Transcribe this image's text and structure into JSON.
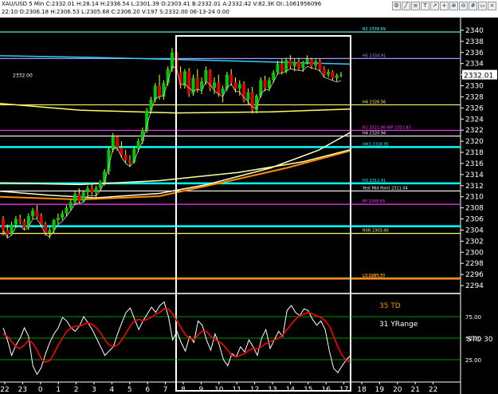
{
  "header": {
    "line1": "XAU/USD 5 Min  C:2332.01  H:28.14  H:2336.54  L:2301.39  O:2303.41  B:2332.01  A:2332.42  V:82.3K  OI:.1061956096",
    "line2": "22:10  O:2306.18  H:2306.53  L:2305.68  C:2306.20  V:197  S:2332.00  06-13-24  0:00"
  },
  "tools": [
    "gear-icon",
    "line-icon",
    "fib-icon",
    "text-icon",
    "arrow-icon",
    "cross-icon",
    "zoom-in-icon",
    "zoom-out-icon",
    "grid-icon",
    "window-icon",
    "close-icon"
  ],
  "price_label_left": "2332.00",
  "last_price": "2332.01",
  "colors": {
    "background": "#000000",
    "candle": "#00cc00",
    "cyan": "#00ffff",
    "yellow": "#ffff66",
    "orange": "#ff8c00",
    "magenta": "#ff00ff",
    "white": "#ffffff",
    "red": "#ff0000",
    "wick": "#ffff00"
  },
  "chart_data": [
    {
      "type": "candlestick",
      "ylim": [
        2293,
        2342
      ],
      "y_ticks": [
        "2340.00",
        "2338.00",
        "2336.00",
        "2334.00",
        "2332.00",
        "2330.00",
        "2328.00",
        "2326.00",
        "2324.00",
        "2322.00",
        "2320.00",
        "2318.00",
        "2316.00",
        "2314.00",
        "2312.00",
        "2310.00",
        "2308.00",
        "2306.00",
        "2304.00",
        "2302.00",
        "2300.00",
        "2298.00",
        "2296.00",
        "2294.00"
      ],
      "x_ticks": [
        "22",
        "23",
        "0",
        "1",
        "2",
        "3",
        "4",
        "5",
        "6",
        "7",
        "8",
        "9",
        "10",
        "11",
        "12",
        "13",
        "14",
        "15",
        "16",
        "17",
        "18",
        "19",
        "20",
        "21",
        "22"
      ],
      "candles": [
        [
          2306,
          2306.5,
          2303,
          2304
        ],
        [
          2304,
          2305,
          2302.5,
          2303.2
        ],
        [
          2303.2,
          2305.5,
          2303,
          2305
        ],
        [
          2305,
          2306.5,
          2304.5,
          2306
        ],
        [
          2306,
          2306.8,
          2305,
          2305.5
        ],
        [
          2305.5,
          2306,
          2304,
          2304.5
        ],
        [
          2304.5,
          2307,
          2304,
          2306.5
        ],
        [
          2306.5,
          2308,
          2306,
          2307.5
        ],
        [
          2307.5,
          2308.5,
          2306,
          2306.5
        ],
        [
          2306.5,
          2307,
          2304.5,
          2305
        ],
        [
          2305,
          2305.5,
          2303,
          2303.5
        ],
        [
          2303.5,
          2304.5,
          2302.5,
          2304
        ],
        [
          2304,
          2306,
          2303.5,
          2305.8
        ],
        [
          2305.8,
          2307,
          2305,
          2306.2
        ],
        [
          2306.2,
          2307.5,
          2305.8,
          2307
        ],
        [
          2307,
          2308.5,
          2306.5,
          2308
        ],
        [
          2308,
          2309.5,
          2307.5,
          2309
        ],
        [
          2309,
          2311,
          2308.5,
          2310.5
        ],
        [
          2310.5,
          2311.5,
          2308.8,
          2309.2
        ],
        [
          2309.2,
          2311,
          2309,
          2310.8
        ],
        [
          2310.8,
          2312,
          2310,
          2311.5
        ],
        [
          2311.5,
          2312.2,
          2310.3,
          2310.8
        ],
        [
          2310.8,
          2312,
          2309.5,
          2311.6
        ],
        [
          2311.6,
          2313,
          2311,
          2312.6
        ],
        [
          2312.6,
          2315,
          2312,
          2314.6
        ],
        [
          2314.6,
          2319,
          2314,
          2318.5
        ],
        [
          2318.5,
          2321.5,
          2318,
          2320.8
        ],
        [
          2320.8,
          2321,
          2318.3,
          2318.8
        ],
        [
          2318.8,
          2320,
          2317,
          2317.5
        ],
        [
          2317.5,
          2318.5,
          2316,
          2316.6
        ],
        [
          2316.6,
          2317.5,
          2315.5,
          2316.2
        ],
        [
          2316.2,
          2319,
          2316,
          2318.6
        ],
        [
          2318.6,
          2320.5,
          2318,
          2320
        ],
        [
          2320,
          2322.5,
          2319.5,
          2322
        ],
        [
          2322,
          2326,
          2321.5,
          2325.5
        ],
        [
          2325.5,
          2328,
          2325,
          2327.5
        ],
        [
          2327.5,
          2330.5,
          2327,
          2330
        ],
        [
          2330,
          2332,
          2327.5,
          2328
        ],
        [
          2328,
          2331,
          2327.5,
          2330.5
        ],
        [
          2330.5,
          2333.5,
          2330,
          2333
        ],
        [
          2333,
          2336.8,
          2332.5,
          2336
        ],
        [
          2336,
          2336.5,
          2331.5,
          2332.4
        ],
        [
          2332.4,
          2333.5,
          2329.5,
          2330
        ],
        [
          2330,
          2333,
          2329.5,
          2332.6
        ],
        [
          2332.6,
          2333.2,
          2328,
          2328.6
        ],
        [
          2328.6,
          2332,
          2328.2,
          2331.4
        ],
        [
          2331.4,
          2333,
          2328.8,
          2329.4
        ],
        [
          2329.4,
          2331.5,
          2328.5,
          2330.8
        ],
        [
          2330.8,
          2333.5,
          2330.2,
          2332.8
        ],
        [
          2332.8,
          2333,
          2329,
          2329.6
        ],
        [
          2329.6,
          2331.5,
          2328.5,
          2330.6
        ],
        [
          2330.6,
          2332,
          2328,
          2328.5
        ],
        [
          2328.5,
          2330,
          2327,
          2329.5
        ],
        [
          2329.5,
          2332.5,
          2329,
          2332
        ],
        [
          2332,
          2333,
          2330,
          2330.6
        ],
        [
          2330.6,
          2331.5,
          2328.8,
          2329.5
        ],
        [
          2329.5,
          2331,
          2328.2,
          2330.3
        ],
        [
          2330.3,
          2330.8,
          2327,
          2327.5
        ],
        [
          2327.5,
          2329.5,
          2326.5,
          2328.8
        ],
        [
          2328.8,
          2329.8,
          2325,
          2325.6
        ],
        [
          2325.6,
          2328.5,
          2325,
          2328.2
        ],
        [
          2328.2,
          2331.5,
          2327.8,
          2331
        ],
        [
          2331,
          2331.8,
          2329,
          2329.6
        ],
        [
          2329.6,
          2331.5,
          2329,
          2331
        ],
        [
          2331,
          2332.8,
          2330.5,
          2332.4
        ],
        [
          2332.4,
          2334.5,
          2332,
          2334
        ],
        [
          2334,
          2334.8,
          2332,
          2332.6
        ],
        [
          2332.6,
          2335,
          2332.2,
          2334.6
        ],
        [
          2334.6,
          2335.5,
          2333,
          2333.5
        ],
        [
          2333.5,
          2334.8,
          2332.6,
          2334.3
        ],
        [
          2334.3,
          2335,
          2332.8,
          2333.2
        ],
        [
          2333.2,
          2334.5,
          2332.5,
          2334.2
        ],
        [
          2334.2,
          2335.5,
          2333.8,
          2334.8
        ],
        [
          2334.8,
          2335,
          2333,
          2333.6
        ],
        [
          2333.6,
          2334.8,
          2333,
          2334.4
        ],
        [
          2334.4,
          2334.8,
          2332.5,
          2333
        ],
        [
          2333,
          2333.5,
          2331.5,
          2332
        ],
        [
          2332,
          2333,
          2331.5,
          2332.5
        ],
        [
          2332.5,
          2332.8,
          2331,
          2331.4
        ],
        [
          2331.4,
          2332.2,
          2330.8,
          2331.9
        ],
        [
          2331.9,
          2332.5,
          2331.5,
          2332.01
        ]
      ],
      "levels": [
        {
          "price": 2339.69,
          "label": "R2  2339.69",
          "color": "#66ffff"
        },
        {
          "price": 2334.91,
          "label": "H5  2334.91",
          "color": "#9999ff"
        },
        {
          "price": 2326.56,
          "label": "H4  2326.56",
          "color": "#ffff66"
        },
        {
          "price": 2321.96,
          "label": "R1  2321.96   WP  2321.83",
          "color": "#ff33ff"
        },
        {
          "price": 2320.94,
          "label": "H4  2320.94",
          "color": "#ffffff"
        },
        {
          "price": 2318.95,
          "label": "HH3  2318.95",
          "color": "#00ffff"
        },
        {
          "price": 2312.41,
          "label": "H3  2312.41",
          "color": "#00ffff"
        },
        {
          "price": 2311.04,
          "label": "Yest Mid Point  2311.04",
          "color": "#ffffff"
        },
        {
          "price": 2308.65,
          "label": "PP  2308.65",
          "color": "#ff33ff"
        },
        {
          "price": 2304.7,
          "label": "",
          "color": "#00ffff"
        },
        {
          "price": 2303.4,
          "label": "RXR  2303.40",
          "color": "#ffff66"
        },
        {
          "price": 2295.33,
          "label": "L3  2295.33",
          "color": "#ffff00"
        },
        {
          "price": 2295.12,
          "label": "S  2295.12",
          "color": "#ff3333"
        }
      ]
    },
    {
      "type": "line",
      "ylim": [
        0,
        100
      ],
      "y_ticks": [
        "75.00",
        "50.00",
        "25.00"
      ],
      "labels": {
        "td": "35 TD",
        "yrange": "31 YRange",
        "sto": "STO  30"
      },
      "series": [
        {
          "color": "#ffffff",
          "values": [
            62,
            48,
            30,
            42,
            50,
            62,
            52,
            18,
            8,
            16,
            32,
            45,
            55,
            62,
            74,
            70,
            62,
            58,
            64,
            75,
            68,
            60,
            50,
            40,
            30,
            35,
            40,
            55,
            68,
            80,
            85,
            72,
            60,
            70,
            78,
            86,
            80,
            88,
            92,
            75,
            48,
            58,
            45,
            35,
            52,
            45,
            70,
            65,
            48,
            36,
            55,
            42,
            25,
            18,
            32,
            28,
            40,
            34,
            48,
            40,
            30,
            50,
            60,
            38,
            48,
            58,
            52,
            82,
            88,
            80,
            76,
            84,
            82,
            72,
            65,
            70,
            60,
            35,
            15,
            10,
            18,
            25,
            30
          ]
        },
        {
          "color": "#ff0000",
          "values": [
            55,
            52,
            46,
            40,
            38,
            42,
            48,
            44,
            36,
            26,
            22,
            24,
            32,
            42,
            50,
            58,
            62,
            64,
            64,
            66,
            68,
            66,
            62,
            56,
            48,
            42,
            40,
            42,
            48,
            56,
            64,
            70,
            72,
            70,
            72,
            74,
            78,
            80,
            84,
            84,
            78,
            70,
            62,
            54,
            50,
            48,
            54,
            58,
            58,
            52,
            48,
            46,
            42,
            36,
            30,
            28,
            30,
            32,
            36,
            38,
            38,
            40,
            44,
            46,
            48,
            50,
            54,
            60,
            66,
            72,
            76,
            78,
            80,
            78,
            76,
            74,
            70,
            64,
            52,
            40,
            30,
            24,
            22
          ]
        }
      ]
    }
  ]
}
